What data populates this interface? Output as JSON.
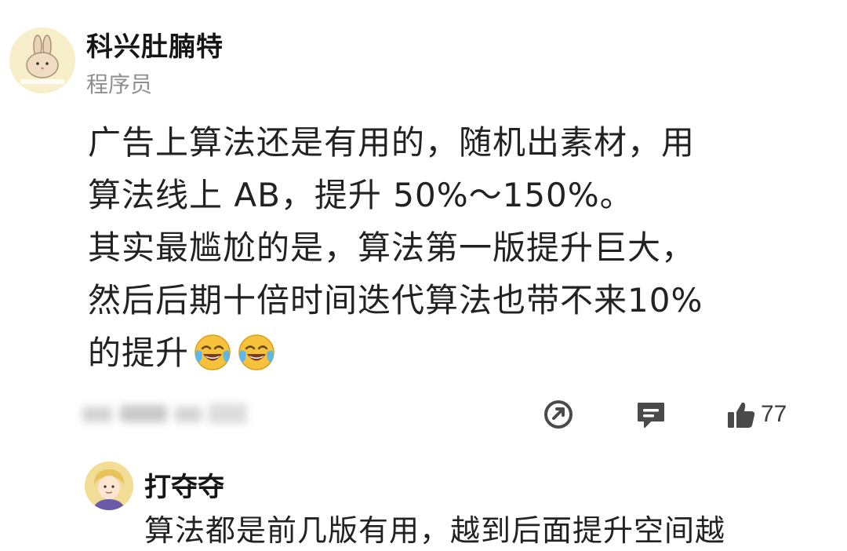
{
  "post": {
    "author": {
      "name": "科兴肚腩特",
      "title": "程序员"
    },
    "content_lines": [
      "广告上算法还是有用的，随机出素材，用",
      "算法线上 AB，提升 50%～150%。",
      "其实最尴尬的是，算法第一版提升巨大，",
      "然后后期十倍时间迭代算法也带不来10%",
      "的提升"
    ],
    "emojis": [
      "tears-of-joy-emoji",
      "tears-of-joy-emoji"
    ],
    "actions": {
      "share_icon": "share-icon",
      "comment_icon": "comment-icon",
      "like_icon": "thumbs-up-icon",
      "like_count": "77"
    }
  },
  "reply": {
    "author": {
      "name": "打夺夺"
    },
    "content": "算法都是前几版有用，越到后面提升空间越"
  },
  "colors": {
    "text": "#222222",
    "secondary_text": "#8f8f8f",
    "icon": "#4a4a4a",
    "emoji": "#f7c23b"
  }
}
